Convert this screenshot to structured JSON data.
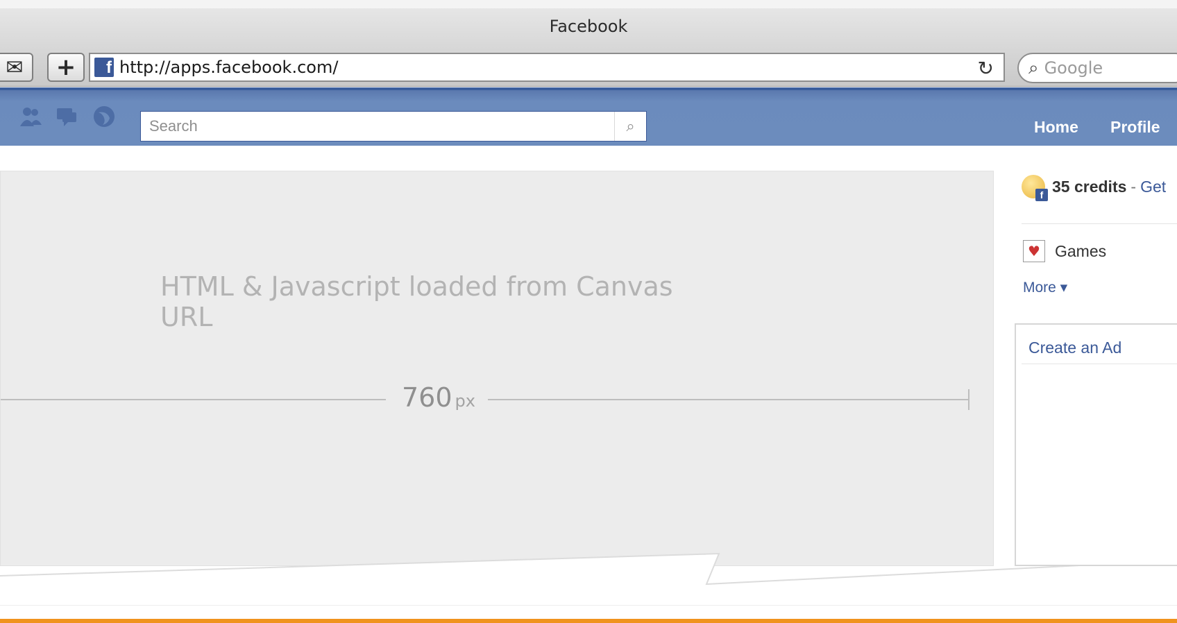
{
  "browser": {
    "window_title": "Facebook",
    "url": "http://apps.facebook.com/",
    "search_placeholder": "Google",
    "favicon_letter": "f",
    "icons": [
      "mail-icon",
      "plus-icon",
      "reload-icon",
      "magnifier-icon"
    ]
  },
  "facebook": {
    "search_placeholder": "Search",
    "nav": {
      "home": "Home",
      "profile": "Profile"
    },
    "jewel_icons": [
      "friends-icon",
      "messages-icon",
      "notifications-icon"
    ],
    "brand_color": "#3b5998"
  },
  "canvas": {
    "caption": "HTML & Javascript loaded from Canvas URL",
    "width_value": "760",
    "width_unit": "px"
  },
  "sidebar": {
    "credits": "35 credits",
    "credits_separator": "-",
    "credits_link": "Get",
    "games_label": "Games",
    "more_label": "More ▾",
    "ad_title": "Create an Ad"
  },
  "colors": {
    "accent_orange": "#f0931e",
    "link_blue": "#3b5998",
    "canvas_gray": "#ececec"
  }
}
